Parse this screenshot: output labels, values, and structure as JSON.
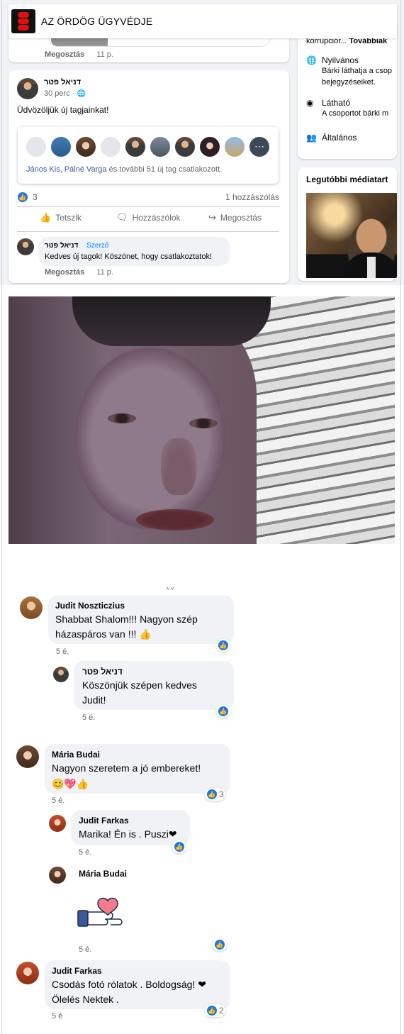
{
  "header": {
    "group_title": "AZ ÖRDÖG ÜGYVÉDJE"
  },
  "prev_post": {
    "share_label": "Megosztás",
    "time": "11 p."
  },
  "post": {
    "author": "דניאל פטר",
    "time": "30 perc ·",
    "globe_icon": "globe-icon",
    "text": "Üdvözöljük új tagjainkat!",
    "join_names": "János Kis, Pálné Varga",
    "join_rest": " és további 51 új tag csatlakozott.",
    "reaction_count": "3",
    "comment_count": "1 hozzászólás",
    "actions": {
      "like": "Tetszik",
      "comment": "Hozzászólok",
      "share": "Megosztás"
    },
    "comment": {
      "author": "דניאל פטר",
      "badge": "Szerző",
      "text": "Kedves új tagok! Köszönet, hogy csatlakoztatok!",
      "share_label": "Megosztás",
      "time": "11 p."
    }
  },
  "sidebar": {
    "about_snippet": "korrupciór...",
    "more_label": "Továbbiak",
    "public_title": "Nyilvános",
    "public_desc_1": "Bárki láthatja a csop",
    "public_desc_2": "bejegyzéseiket.",
    "visible_title": "Látható",
    "visible_desc": "A csoportot bárki m",
    "general_title": "Általános",
    "media_title": "Legutóbbi médiatart"
  },
  "comments": [
    {
      "name": "Judit Noszticzius",
      "line1": "Shabbat Shalom!!! Nagyon szép",
      "line2": "házaspáros van !!! 👍",
      "time": "5 é."
    },
    {
      "name": "דניאל פטר",
      "line1": "Köszönjük szépen kedves",
      "line2": "Judit!",
      "time": "5 é."
    },
    {
      "name": "Mária Budai",
      "line1": "Nagyon szeretem a jó embereket!",
      "line2": "😊💖👍",
      "time": "5 é.",
      "reactions": "3"
    },
    {
      "name": "Judit Farkas",
      "line1": "Marika! Én is . Puszi❤",
      "time": "5 é."
    },
    {
      "name": "Mária Budai",
      "time": "5 é."
    },
    {
      "name": "Judit Farkas",
      "line1": "Csodás fotó rólatok . Boldogság! ❤",
      "line2": "Ölelés Nektek .",
      "time": "5 é",
      "reactions": "2"
    }
  ],
  "icons": {
    "like": "thumbs-up-icon",
    "comment": "comment-icon",
    "share": "share-icon",
    "globe": "globe-icon",
    "eye": "eye-icon",
    "people": "people-icon",
    "heart_hand": "heart-hand-sticker-icon"
  },
  "colors": {
    "facebook_blue": "#1877f2",
    "feed_bg": "#f0f2f5",
    "muted_text": "#65676b"
  }
}
